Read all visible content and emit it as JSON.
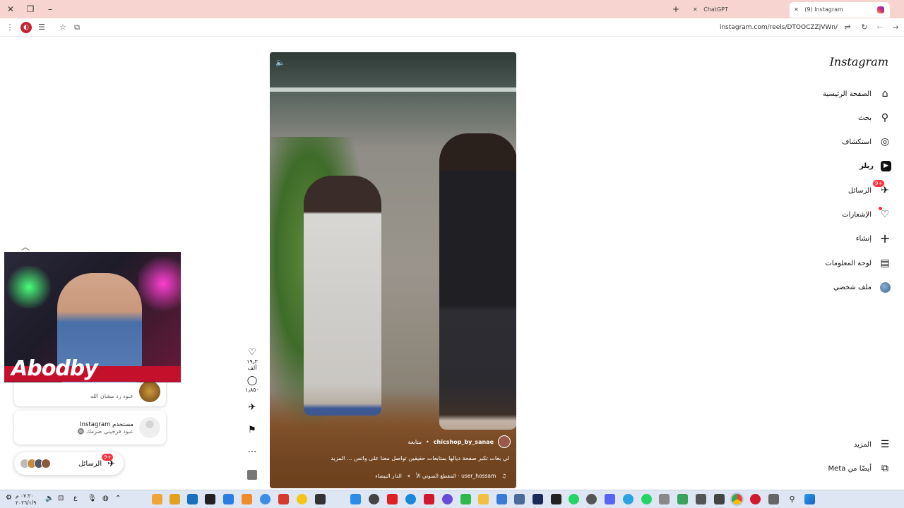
{
  "browser": {
    "tabs": [
      {
        "title": "ChatGPT",
        "active": false
      },
      {
        "title": "(9) Instagram",
        "active": true
      }
    ],
    "url": "instagram.com/reels/DTOOCZZjVWn/"
  },
  "instagram": {
    "logo": "Instagram",
    "nav": [
      {
        "label": "الصفحة الرئيسية",
        "icon": "home-icon",
        "glyph": "⌂"
      },
      {
        "label": "بحث",
        "icon": "search-icon",
        "glyph": "⚲"
      },
      {
        "label": "استكشاف",
        "icon": "explore-icon",
        "glyph": "◎"
      },
      {
        "label": "ريلز",
        "icon": "reels-icon",
        "glyph": "▶"
      },
      {
        "label": "الرسائل",
        "icon": "messages-icon",
        "glyph": "✈",
        "badge": "+9"
      },
      {
        "label": "الإشعارات",
        "icon": "heart-icon",
        "glyph": "♡"
      },
      {
        "label": "إنشاء",
        "icon": "create-icon",
        "glyph": "+"
      },
      {
        "label": "لوحة المعلومات",
        "icon": "dashboard-icon",
        "glyph": "▤"
      },
      {
        "label": "ملف شخصي",
        "icon": "profile-avatar-icon",
        "glyph": "●"
      }
    ],
    "more_label": "المزيد",
    "also_from_meta": "أيضًا من Meta"
  },
  "reel": {
    "username": "chicshop_by_sanae",
    "follow": "متابعة",
    "caption": "لي بغات تكبر صفحة ديالها بمتابعات حقيقين تواصل معنا على واتس ... المزيد",
    "audio": "user_hossam · المقطع الصوتي الأ",
    "location": "الدار البيضاء",
    "likes": "١٩٫٣ ألف",
    "comments": "١٫٨٥٠"
  },
  "messages": {
    "rows": [
      {
        "name": "",
        "preview": "عبود رد مشان الله"
      },
      {
        "name": "مستخدم Instagram",
        "preview": "عبود فرجيني ضرمك 🔘"
      }
    ],
    "pill_label": "الرسائل",
    "pill_badge": "+9"
  },
  "webcam": {
    "overlay_text": "Abodby"
  },
  "taskbar": {
    "time": "٠٧:٢٠ م",
    "date": "٢٠٢٦/١/٩",
    "lang": "ع"
  }
}
